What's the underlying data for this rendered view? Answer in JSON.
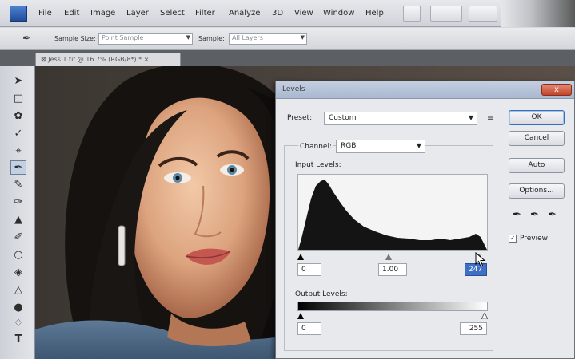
{
  "menu": {
    "items": [
      "File",
      "Edit",
      "Image",
      "Layer",
      "Select",
      "Filter",
      "Analyze",
      "3D",
      "View",
      "Window",
      "Help"
    ]
  },
  "options": {
    "sample_size_label": "Sample Size:",
    "sample_size_value": "Point Sample",
    "sample_label": "Sample:",
    "sample_value": "All Layers"
  },
  "document": {
    "tab_label": "⊠ Jess 1.tif @ 16.7% (RGB/8*) * ×"
  },
  "dialog": {
    "title": "Levels",
    "close_label": "x",
    "preset_label": "Preset:",
    "preset_value": "Custom",
    "channel_label": "Channel:",
    "channel_value": "RGB",
    "input_levels_label": "Input Levels:",
    "input_black": "0",
    "input_gamma": "1.00",
    "input_white": "247",
    "output_levels_label": "Output Levels:",
    "output_black": "0",
    "output_white": "255",
    "buttons": {
      "ok": "OK",
      "cancel": "Cancel",
      "auto": "Auto",
      "options": "Options..."
    },
    "preview_label": "Preview",
    "preview_checked": true
  },
  "colors": {
    "accent": "#3d6fc4",
    "close": "#c0432b"
  }
}
